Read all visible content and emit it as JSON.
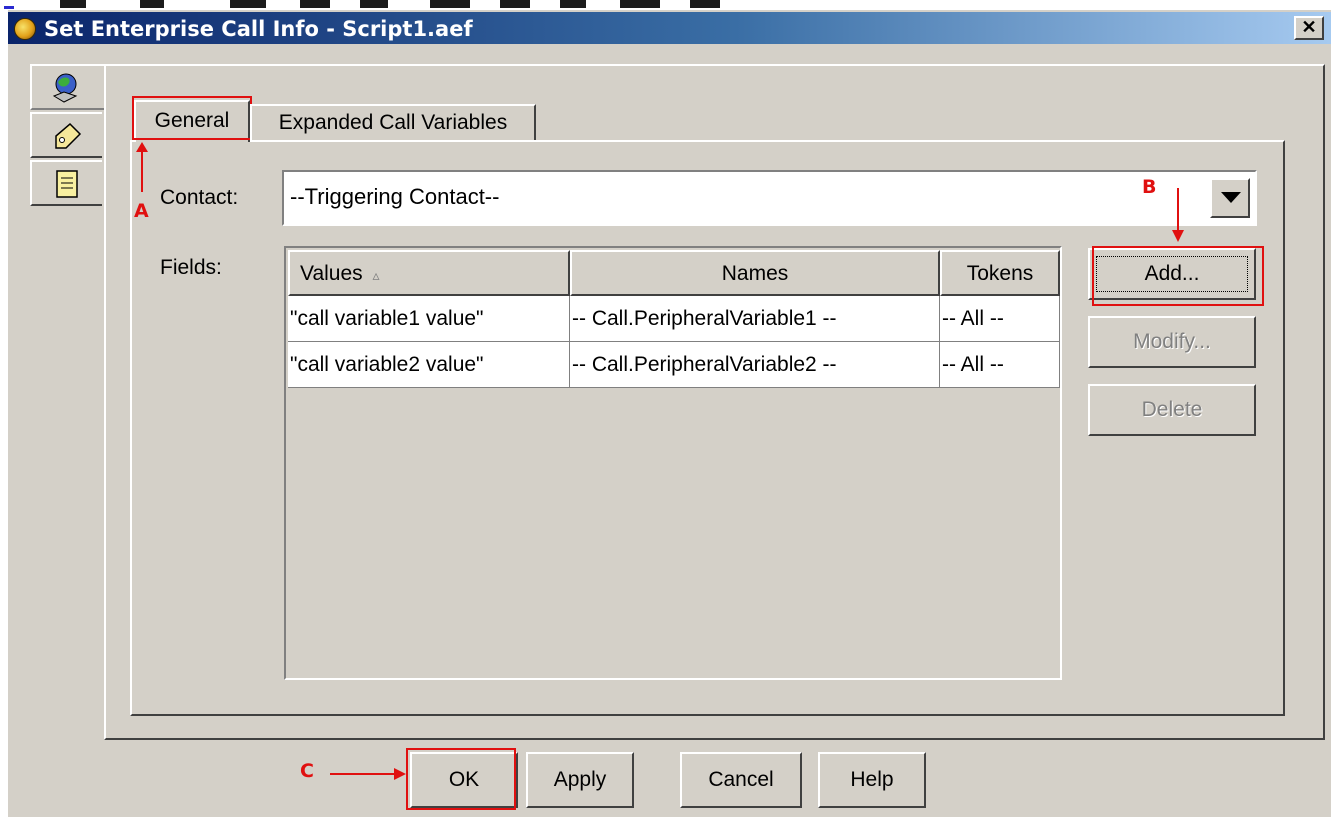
{
  "window": {
    "title": "Set Enterprise Call Info - Script1.aef",
    "close_label": "✕"
  },
  "side_tabs": [
    {
      "icon": "globe-phone-icon"
    },
    {
      "icon": "tag-icon"
    },
    {
      "icon": "document-icon"
    }
  ],
  "tabs": [
    {
      "label": "General",
      "active": true
    },
    {
      "label": "Expanded Call Variables",
      "active": false
    }
  ],
  "form": {
    "contact_label": "Contact:",
    "contact_value": "--Triggering Contact--",
    "fields_label": "Fields:"
  },
  "table": {
    "columns": [
      "Values",
      "Names",
      "Tokens"
    ],
    "sort_indicator": "▵",
    "rows": [
      [
        "\"call variable1 value\"",
        "-- Call.PeripheralVariable1 --",
        "-- All --"
      ],
      [
        "\"call variable2 value\"",
        "-- Call.PeripheralVariable2 --",
        "-- All --"
      ]
    ]
  },
  "side_buttons": {
    "add": "Add...",
    "modify": "Modify...",
    "delete": "Delete"
  },
  "bottom_buttons": {
    "ok": "OK",
    "apply": "Apply",
    "cancel": "Cancel",
    "help": "Help"
  },
  "annotations": {
    "a": "A",
    "b": "B",
    "c": "C",
    "color": "#e01010"
  },
  "colors": {
    "dialog_bg": "#d4d0c8",
    "title_gradient_start": "#0a246a",
    "title_gradient_end": "#a6caf0"
  }
}
